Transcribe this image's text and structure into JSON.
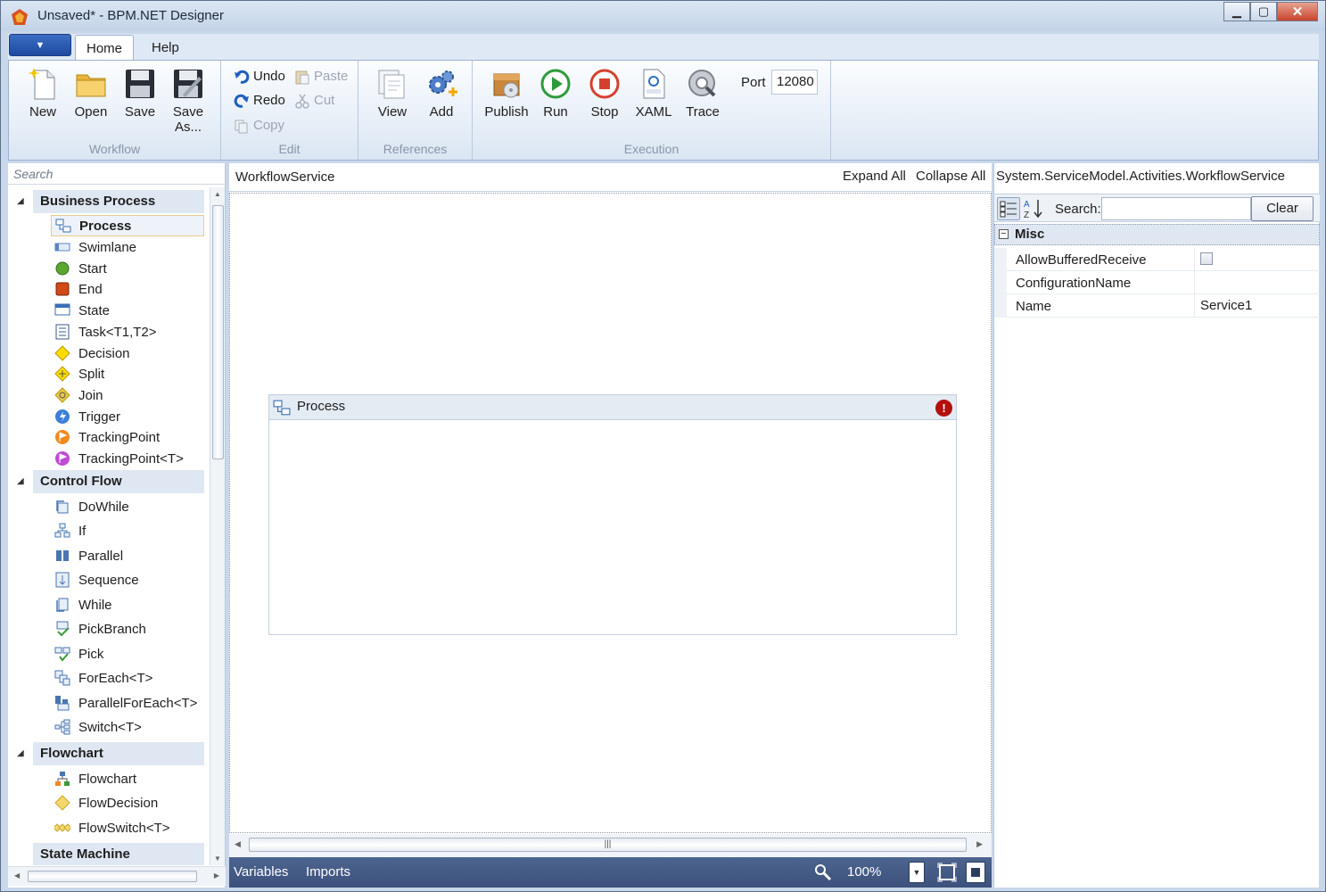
{
  "window": {
    "title": "Unsaved* - BPM.NET Designer"
  },
  "ribbon": {
    "tabs": [
      {
        "label": "Home"
      },
      {
        "label": "Help"
      }
    ],
    "workflow": {
      "label": "Workflow",
      "new": "New",
      "open": "Open",
      "save": "Save",
      "save_as": "Save As..."
    },
    "edit": {
      "label": "Edit",
      "undo": "Undo",
      "redo": "Redo",
      "copy": "Copy",
      "paste": "Paste",
      "cut": "Cut"
    },
    "references": {
      "label": "References",
      "view": "View",
      "add": "Add"
    },
    "execution": {
      "label": "Execution",
      "publish": "Publish",
      "run": "Run",
      "stop": "Stop",
      "xaml": "XAML",
      "trace": "Trace",
      "port_label": "Port",
      "port_value": "12080"
    }
  },
  "toolbox": {
    "search_placeholder": "Search",
    "categories": [
      {
        "label": "Business Process",
        "items": [
          "Process",
          "Swimlane",
          "Start",
          "End",
          "State",
          "Task<T1,T2>",
          "Decision",
          "Split",
          "Join",
          "Trigger",
          "TrackingPoint",
          "TrackingPoint<T>"
        ]
      },
      {
        "label": "Control Flow",
        "items": [
          "DoWhile",
          "If",
          "Parallel",
          "Sequence",
          "While",
          "PickBranch",
          "Pick",
          "ForEach<T>",
          "ParallelForEach<T>",
          "Switch<T>"
        ]
      },
      {
        "label": "Flowchart",
        "items": [
          "Flowchart",
          "FlowDecision",
          "FlowSwitch<T>"
        ]
      },
      {
        "label": "State Machine",
        "items": []
      }
    ]
  },
  "designer": {
    "breadcrumb": "WorkflowService",
    "expand_all": "Expand All",
    "collapse_all": "Collapse All",
    "activity_label": "Process",
    "error_glyph": "!",
    "variables": "Variables",
    "imports": "Imports",
    "zoom": "100%"
  },
  "properties": {
    "type_name": "System.ServiceModel.Activities.WorkflowService",
    "search_label": "Search:",
    "clear_label": "Clear",
    "category": "Misc",
    "rows": [
      {
        "name": "AllowBufferedReceive",
        "value": ""
      },
      {
        "name": "ConfigurationName",
        "value": ""
      },
      {
        "name": "Name",
        "value": "Service1"
      }
    ]
  }
}
